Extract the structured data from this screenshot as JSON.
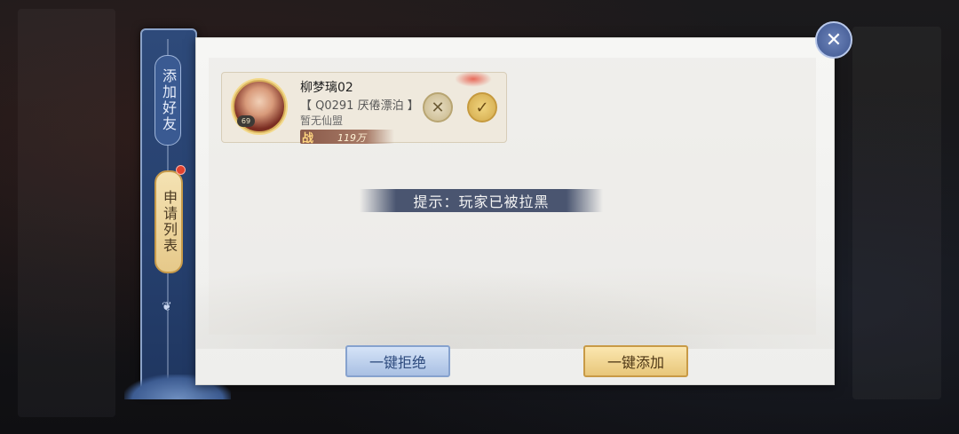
{
  "tabs": {
    "add_friend": "添加好友",
    "request_list": "申请列表"
  },
  "request": {
    "name": "柳梦璃02",
    "server": "【 Q0291 厌倦漂泊 】",
    "guild": "暂无仙盟",
    "level": "69",
    "power_icon": "战",
    "power_value": "119万"
  },
  "toast": {
    "text": "提示：玩家已被拉黑"
  },
  "buttons": {
    "reject_all": "一键拒绝",
    "add_all": "一键添加",
    "reject_symbol": "✕",
    "accept_symbol": "✓",
    "close_symbol": "✕"
  },
  "colors": {
    "rail_blue": "#2e4a7a",
    "gold": "#e8c77a",
    "notification_red": "#e2422e"
  }
}
